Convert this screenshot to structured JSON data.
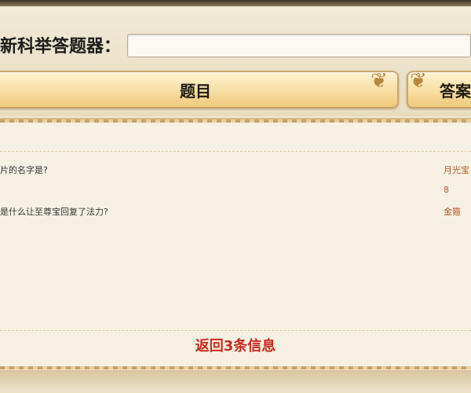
{
  "search": {
    "label": "新科举答题器：",
    "value": ""
  },
  "tabs": {
    "question": "题目",
    "answer": "答案"
  },
  "results": [
    {
      "question": "片的名字是?",
      "answer": "月光宝"
    },
    {
      "question": "",
      "answer": "8"
    },
    {
      "question": "是什么让至尊宝回复了法力?",
      "answer": "金箍"
    }
  ],
  "footer": {
    "status": "返回3条信息"
  },
  "colors": {
    "answer_text": "#b2561b",
    "status_text": "#c72a1c",
    "tab_gold": "#f6dc9d"
  }
}
